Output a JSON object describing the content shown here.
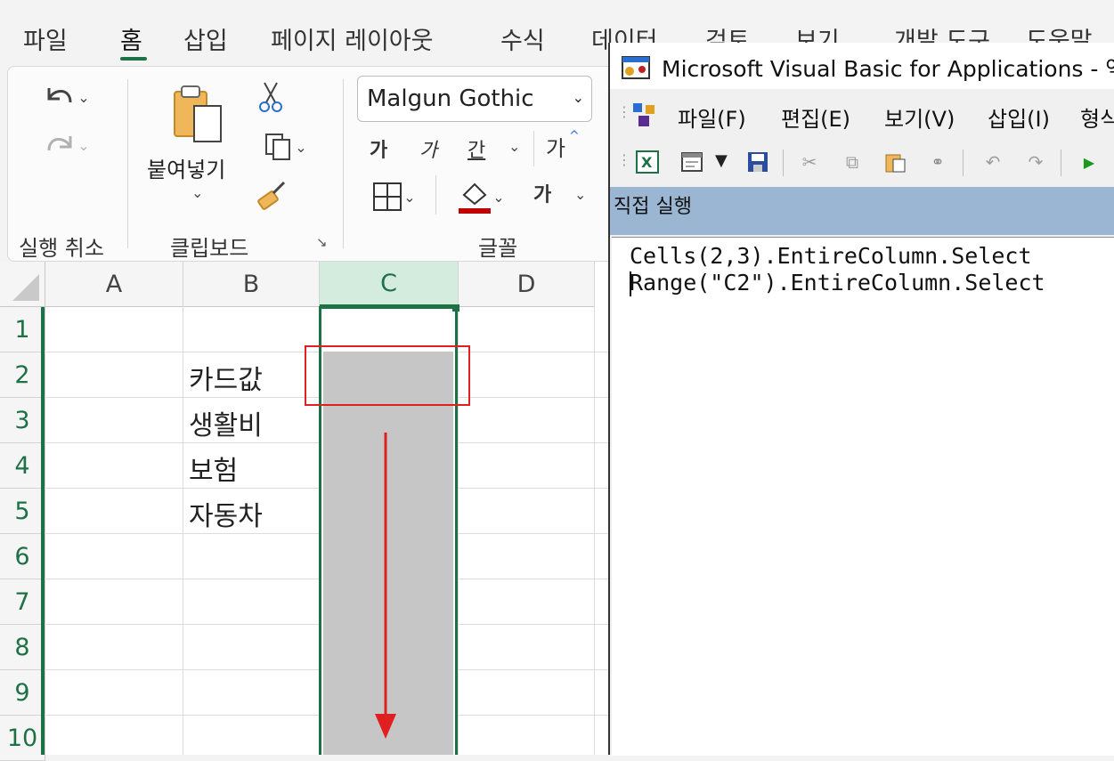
{
  "excel": {
    "tabs": [
      "파일",
      "홈",
      "삽입",
      "페이지 레이아웃",
      "수식",
      "데이터",
      "검토",
      "보기",
      "개발 도구",
      "도움말"
    ],
    "active_tab": "홈",
    "ribbon": {
      "groups": {
        "undo": "실행 취소",
        "clipboard": "클립보드",
        "font": "글꼴"
      },
      "paste_label": "붙여넣기",
      "font_name": "Malgun Gothic",
      "bold_label": "가",
      "italic_label": "가",
      "underline_label": "간",
      "grow_font_label": "가",
      "font_color_label": "가"
    },
    "columns": [
      "A",
      "B",
      "C",
      "D"
    ],
    "selected_column": "C",
    "rows": [
      "1",
      "2",
      "3",
      "4",
      "5",
      "6",
      "7",
      "8",
      "9",
      "10"
    ],
    "b_values": [
      "카드값",
      "생활비",
      "보험",
      "자동차"
    ],
    "colors": {
      "accent": "#1e7145",
      "selection_fill": "#c6c6c6",
      "highlight": "#e02020"
    }
  },
  "vba": {
    "title": "Microsoft Visual Basic for Applications - 엑",
    "menu": [
      "파일(F)",
      "편집(E)",
      "보기(V)",
      "삽입(I)",
      "형식"
    ],
    "immediate_title": "직접 실행",
    "code_lines": [
      "Cells(2,3).EntireColumn.Select",
      "Range(\"C2\").EntireColumn.Select"
    ]
  }
}
